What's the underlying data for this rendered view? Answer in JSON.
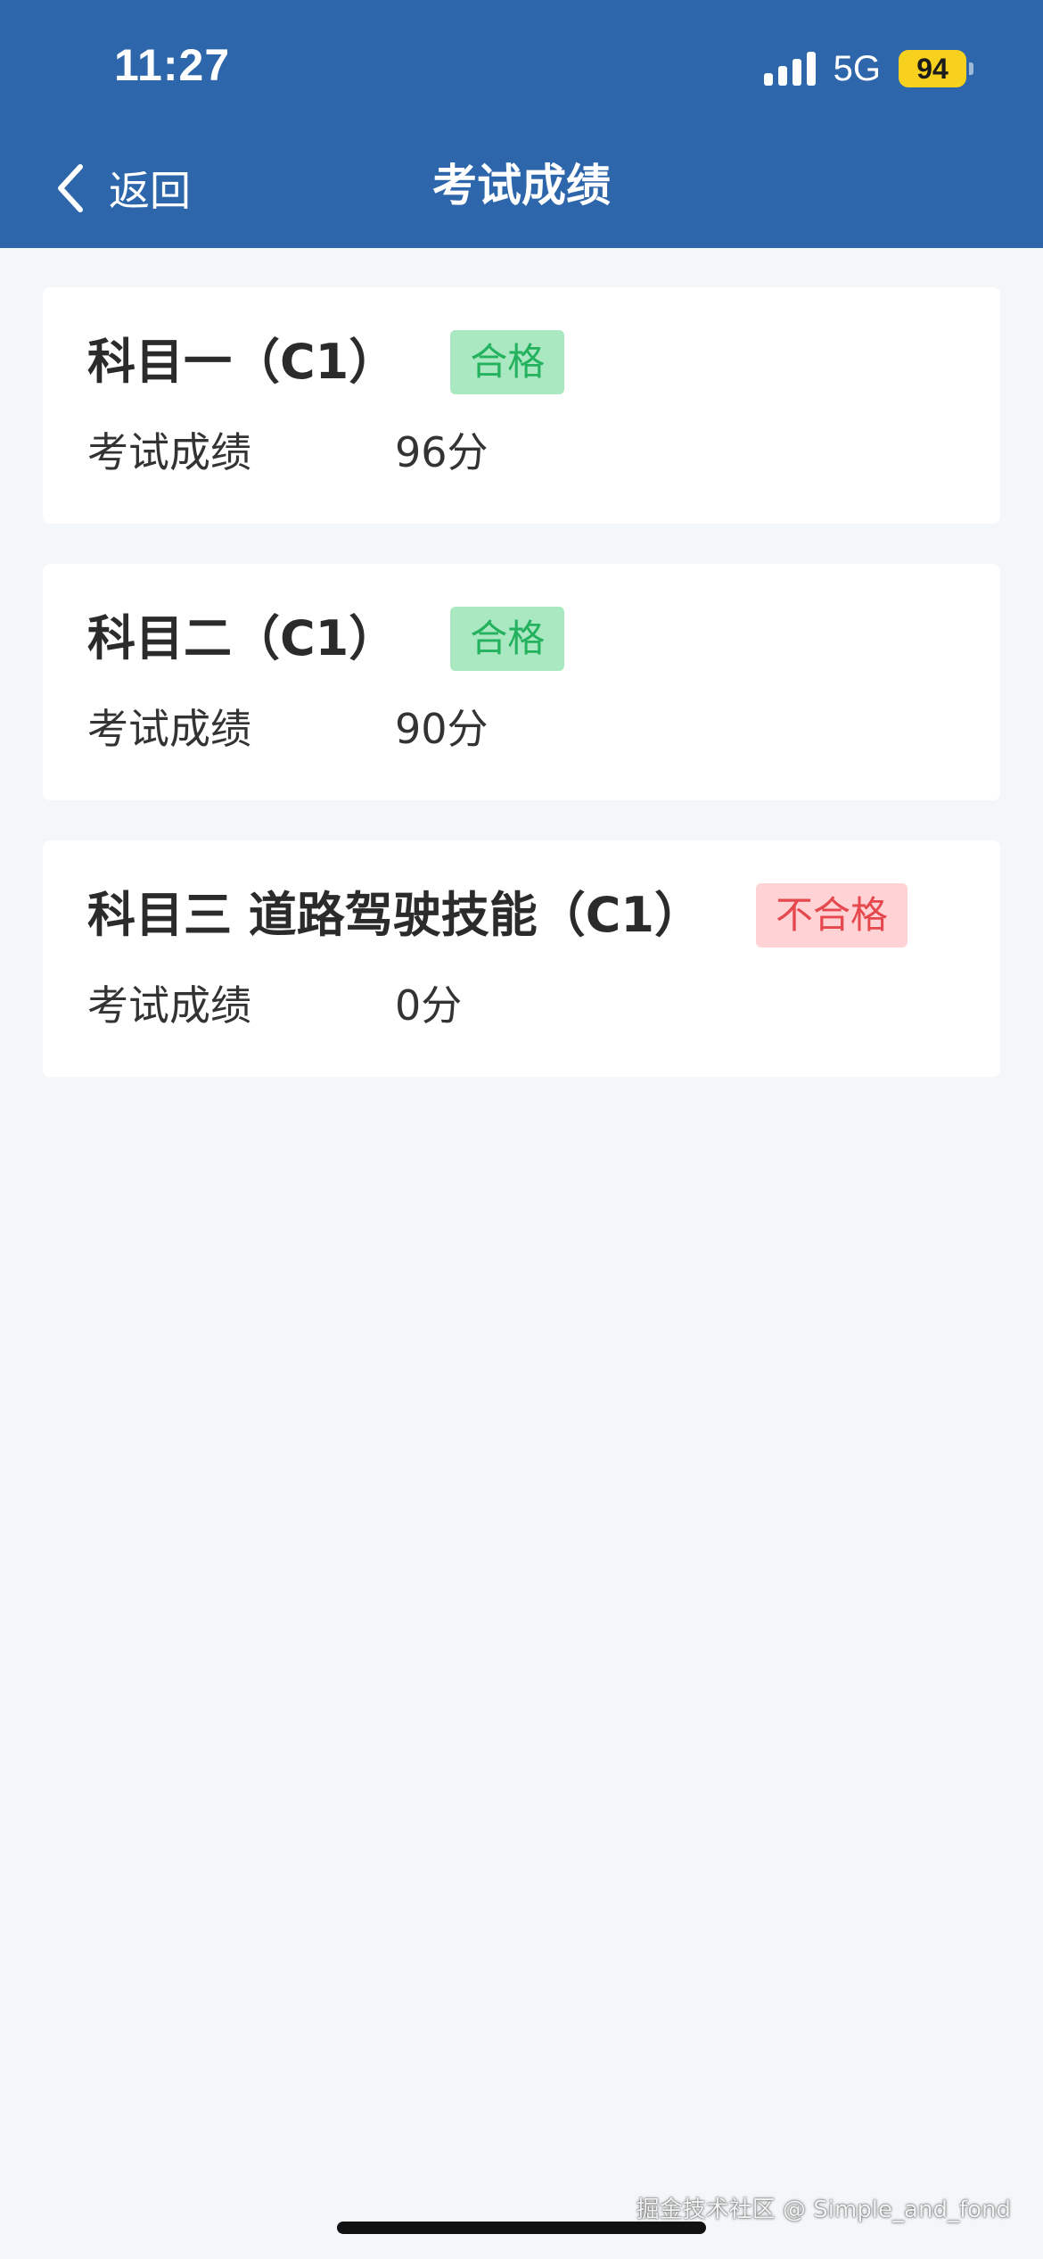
{
  "status_bar": {
    "time": "11:27",
    "network": "5G",
    "battery": "94"
  },
  "nav": {
    "back_label": "返回",
    "title": "考试成绩"
  },
  "results": [
    {
      "subject": "科目一（C1）",
      "status": "合格",
      "passed": true,
      "score_label": "考试成绩",
      "score": "96分"
    },
    {
      "subject": "科目二（C1）",
      "status": "合格",
      "passed": true,
      "score_label": "考试成绩",
      "score": "90分"
    },
    {
      "subject": "科目三 道路驾驶技能（C1）",
      "status": "不合格",
      "passed": false,
      "score_label": "考试成绩",
      "score": "0分"
    }
  ],
  "watermark": "掘金技术社区 @ Simple_and_fond",
  "colors": {
    "header_bg": "#2D66AB",
    "page_bg": "#F4F7F9",
    "pass_bg": "#A9E8C1",
    "pass_text": "#24B25E",
    "fail_bg": "#FFD3D6",
    "fail_text": "#E5484D",
    "battery": "#F7D11E"
  },
  "icons": {
    "back": "chevron-left-icon",
    "signal": "cellular-signal-icon",
    "battery": "battery-icon"
  }
}
